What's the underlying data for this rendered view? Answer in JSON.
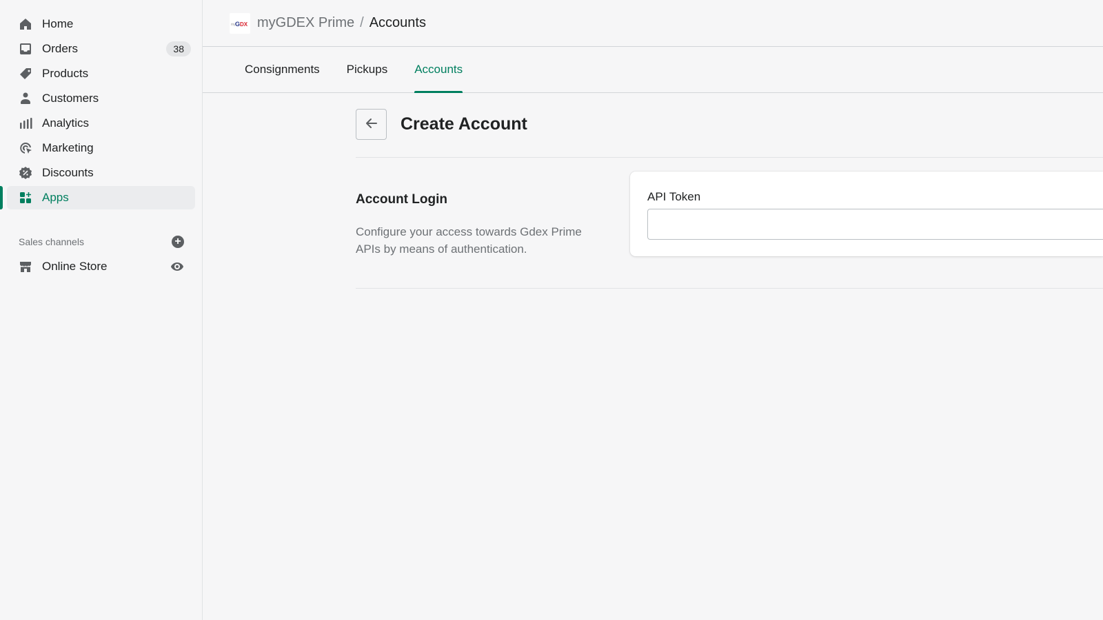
{
  "sidebar": {
    "items": [
      {
        "label": "Home",
        "icon": "home-icon"
      },
      {
        "label": "Orders",
        "icon": "orders-icon",
        "badge": "38"
      },
      {
        "label": "Products",
        "icon": "tag-icon"
      },
      {
        "label": "Customers",
        "icon": "person-icon"
      },
      {
        "label": "Analytics",
        "icon": "bar-chart-icon"
      },
      {
        "label": "Marketing",
        "icon": "marketing-icon"
      },
      {
        "label": "Discounts",
        "icon": "discount-icon"
      },
      {
        "label": "Apps",
        "icon": "apps-icon",
        "active": true
      }
    ],
    "sales_channels": {
      "heading": "Sales channels",
      "add_icon": "plus-circle-icon",
      "items": [
        {
          "label": "Online Store",
          "icon": "store-icon",
          "action_icon": "eye-icon"
        }
      ]
    }
  },
  "header": {
    "app_name": "myGDEX Prime",
    "separator": "/",
    "page": "Accounts"
  },
  "tabs": [
    {
      "label": "Consignments",
      "active": false
    },
    {
      "label": "Pickups",
      "active": false
    },
    {
      "label": "Accounts",
      "active": true
    }
  ],
  "page": {
    "title": "Create Account",
    "back_icon": "arrow-left-icon",
    "section": {
      "title": "Account Login",
      "description": "Configure your access towards Gdex Prime APIs by means of authentication."
    },
    "form": {
      "api_token_label": "API Token",
      "api_token_value": "",
      "api_token_placeholder": ""
    }
  },
  "colors": {
    "accent": "#007f5f",
    "text": "#202223",
    "subdued": "#6d7175",
    "background": "#f6f6f7"
  }
}
